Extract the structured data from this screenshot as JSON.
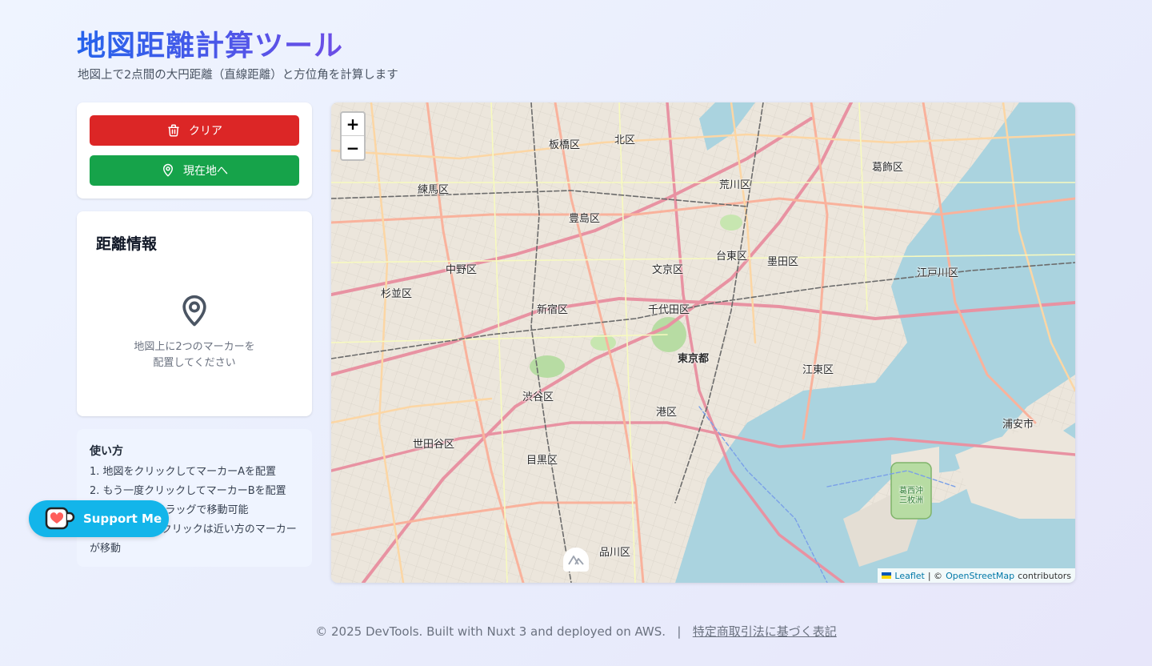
{
  "header": {
    "title": "地図距離計算ツール",
    "subtitle": "地図上で2点間の大円距離（直線距離）と方位角を計算します"
  },
  "actions": {
    "clear_label": "クリア",
    "locate_label": "現在地へ"
  },
  "distance_info": {
    "title": "距離情報",
    "empty_line1": "地図上に2つのマーカーを",
    "empty_line2": "配置してください"
  },
  "howto": {
    "title": "使い方",
    "steps": [
      "1. 地図をクリックしてマーカーAを配置",
      "2. もう一度クリックしてマーカーBを配置",
      "3. マーカーはドラッグで移動可能",
      "4. 3回目以降のクリックは近い方のマーカーが移動"
    ]
  },
  "support": {
    "label": "Support Me"
  },
  "map": {
    "zoom_in": "+",
    "zoom_out": "−",
    "attribution_leaflet": "Leaflet",
    "attribution_sep": "| ©",
    "attribution_osm": "OpenStreetMap",
    "attribution_contrib": "contributors",
    "labels": {
      "itabashi": "板橋区",
      "kita": "北区",
      "nerima": "練馬区",
      "arakawa": "荒川区",
      "katsushika": "葛飾区",
      "toshima": "豊島区",
      "taito": "台東区",
      "sumida": "墨田区",
      "nakano": "中野区",
      "bunkyo": "文京区",
      "edogawa": "江戸川区",
      "suginami": "杉並区",
      "shinjuku": "新宿区",
      "chiyoda": "千代田区",
      "tokyo": "東京都",
      "koto": "江東区",
      "shibuya": "渋谷区",
      "minato": "港区",
      "urayasu": "浦安市",
      "setagaya": "世田谷区",
      "meguro": "目黒区",
      "kasai": "葛西沖三枚洲",
      "shinagawa": "品川区"
    }
  },
  "footer": {
    "copyright": "© 2025 DevTools. Built with Nuxt 3 and deployed on AWS.",
    "separator": "|",
    "link": "特定商取引法に基づく表記"
  },
  "colors": {
    "clear": "#dc2626",
    "locate": "#16a34a",
    "support": "#13b5ea",
    "title_from": "#2563eb",
    "title_to": "#6d4de6"
  }
}
